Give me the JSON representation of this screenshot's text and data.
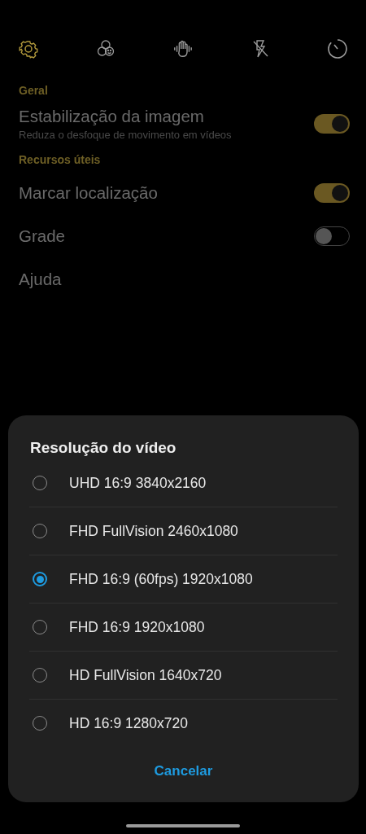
{
  "toolbar": [
    {
      "selected": true
    },
    {
      "selected": false
    },
    {
      "selected": false
    },
    {
      "selected": false
    },
    {
      "selected": false
    }
  ],
  "sections": [
    {
      "header": "Geral",
      "items": [
        {
          "label": "Estabilização da imagem",
          "subtitle": "Reduza o desfoque de movimento em vídeos",
          "kind": "toggle",
          "on": true
        }
      ]
    },
    {
      "header": "Recursos úteis",
      "items": [
        {
          "label": "Marcar localização",
          "kind": "toggle",
          "on": true
        },
        {
          "label": "Grade",
          "kind": "toggle",
          "on": false
        },
        {
          "label": "Ajuda",
          "kind": "link"
        }
      ]
    }
  ],
  "dialog": {
    "title": "Resolução do vídeo",
    "options": [
      {
        "label": "UHD 16:9 3840x2160",
        "selected": false
      },
      {
        "label": "FHD FullVision 2460x1080",
        "selected": false
      },
      {
        "label": "FHD 16:9 (60fps) 1920x1080",
        "selected": true
      },
      {
        "label": "FHD 16:9 1920x1080",
        "selected": false
      },
      {
        "label": "HD FullVision 1640x720",
        "selected": false
      },
      {
        "label": "HD 16:9 1280x720",
        "selected": false
      }
    ],
    "cancel": "Cancelar"
  }
}
